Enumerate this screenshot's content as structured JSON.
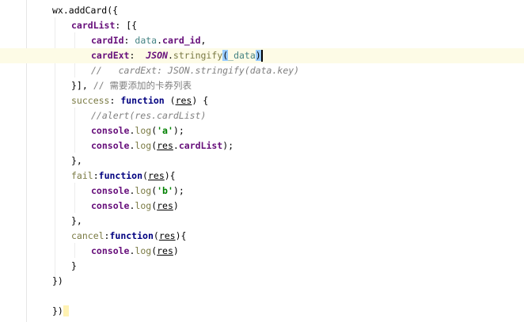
{
  "editor": {
    "current_line": 3,
    "lines": [
      {
        "indent": 66,
        "tokens": [
          [
            "wx.addCard({",
            ""
          ]
        ]
      },
      {
        "indent": 90,
        "tokens": [
          [
            "cardList",
            "prop"
          ],
          [
            ": [{",
            ""
          ]
        ]
      },
      {
        "indent": 115,
        "tokens": [
          [
            "cardId",
            "prop"
          ],
          [
            ": ",
            ""
          ],
          [
            "data",
            "fld"
          ],
          [
            ".",
            ""
          ],
          [
            "card_id",
            "prop"
          ],
          [
            ",",
            ""
          ]
        ]
      },
      {
        "indent": 115,
        "tokens": [
          [
            "cardExt",
            "prop"
          ],
          [
            ":  ",
            ""
          ],
          [
            "JSON",
            "json"
          ],
          [
            ".",
            ""
          ],
          [
            "stringify",
            "fn"
          ],
          [
            "(",
            "hl"
          ],
          [
            "_data",
            "fld"
          ],
          [
            ")",
            "hl"
          ],
          [
            "",
            "caret"
          ]
        ]
      },
      {
        "indent": 115,
        "tokens": [
          [
            "//   cardExt: JSON.stringify(data.key)",
            "cmt"
          ]
        ]
      },
      {
        "indent": 90,
        "tokens": [
          [
            "}], ",
            ""
          ],
          [
            "// 需要添加的卡券列表",
            "cmtz"
          ]
        ]
      },
      {
        "indent": 90,
        "tokens": [
          [
            "success",
            "fn"
          ],
          [
            ": ",
            ""
          ],
          [
            "function",
            "kw"
          ],
          [
            " (",
            ""
          ],
          [
            "res",
            "par"
          ],
          [
            ") {",
            ""
          ]
        ]
      },
      {
        "indent": 115,
        "tokens": [
          [
            "//alert(res.cardList)",
            "cmt"
          ]
        ]
      },
      {
        "indent": 115,
        "tokens": [
          [
            "console",
            "prop"
          ],
          [
            ".",
            ""
          ],
          [
            "log",
            "fn"
          ],
          [
            "(",
            ""
          ],
          [
            "'a'",
            "str"
          ],
          [
            ");",
            ""
          ]
        ]
      },
      {
        "indent": 115,
        "tokens": [
          [
            "console",
            "prop"
          ],
          [
            ".",
            ""
          ],
          [
            "log",
            "fn"
          ],
          [
            "(",
            ""
          ],
          [
            "res",
            "par"
          ],
          [
            ".",
            ""
          ],
          [
            "cardList",
            "prop"
          ],
          [
            ");",
            ""
          ]
        ]
      },
      {
        "indent": 90,
        "tokens": [
          [
            "},",
            ""
          ]
        ]
      },
      {
        "indent": 90,
        "tokens": [
          [
            "fail",
            "fn"
          ],
          [
            ":",
            ""
          ],
          [
            "function",
            "kw"
          ],
          [
            "(",
            ""
          ],
          [
            "res",
            "par"
          ],
          [
            "){",
            ""
          ]
        ]
      },
      {
        "indent": 115,
        "tokens": [
          [
            "console",
            "prop"
          ],
          [
            ".",
            ""
          ],
          [
            "log",
            "fn"
          ],
          [
            "(",
            ""
          ],
          [
            "'b'",
            "str"
          ],
          [
            ");",
            ""
          ]
        ]
      },
      {
        "indent": 115,
        "tokens": [
          [
            "console",
            "prop"
          ],
          [
            ".",
            ""
          ],
          [
            "log",
            "fn"
          ],
          [
            "(",
            ""
          ],
          [
            "res",
            "par"
          ],
          [
            ")",
            ""
          ]
        ]
      },
      {
        "indent": 90,
        "tokens": [
          [
            "},",
            ""
          ]
        ]
      },
      {
        "indent": 90,
        "tokens": [
          [
            "cancel",
            "fn"
          ],
          [
            ":",
            ""
          ],
          [
            "function",
            "kw"
          ],
          [
            "(",
            ""
          ],
          [
            "res",
            "par"
          ],
          [
            "){",
            ""
          ]
        ]
      },
      {
        "indent": 115,
        "tokens": [
          [
            "console",
            "prop"
          ],
          [
            ".",
            ""
          ],
          [
            "log",
            "fn"
          ],
          [
            "(",
            ""
          ],
          [
            "res",
            "par"
          ],
          [
            ")",
            ""
          ]
        ]
      },
      {
        "indent": 90,
        "tokens": [
          [
            "}",
            ""
          ]
        ]
      },
      {
        "indent": 66,
        "tokens": [
          [
            "})",
            ""
          ]
        ]
      },
      {
        "indent": 66,
        "tokens": []
      },
      {
        "indent": 66,
        "tokens": [
          [
            "})",
            ""
          ],
          [
            " ",
            "hly"
          ]
        ]
      }
    ]
  }
}
